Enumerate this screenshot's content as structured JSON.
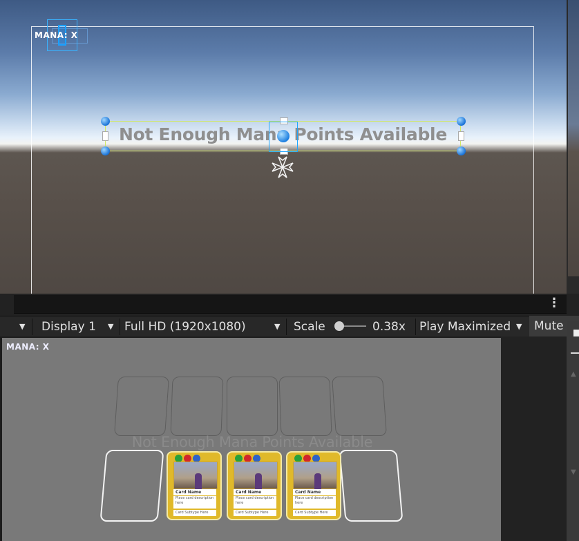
{
  "scene": {
    "mana_label": "MANA: X",
    "message": "Not Enough Mana Points Available"
  },
  "toolbar": {
    "display": "Display 1",
    "resolution": "Full HD (1920x1080)",
    "scale_label": "Scale",
    "scale_value": "0.38x",
    "play_mode": "Play Maximized",
    "mute": "Mute"
  },
  "game": {
    "mana_label": "MANA: X",
    "message": "Not Enough Mana Points Available",
    "cards": [
      {
        "name": "Card Name",
        "description": "Place card description here",
        "footer": "Card Subtype Here"
      },
      {
        "name": "Card Name",
        "description": "Place card description here",
        "footer": "Card Subtype Here"
      },
      {
        "name": "Card Name",
        "description": "Place card description here",
        "footer": "Card Subtype Here"
      }
    ]
  },
  "colors": {
    "accent": "#1aa0ff",
    "selection_outline": "#d2e864",
    "card_gold": "#e0b92a"
  },
  "icons": [
    "kebab-menu-icon",
    "dropdown-arrow-icon",
    "anchor-icon"
  ]
}
